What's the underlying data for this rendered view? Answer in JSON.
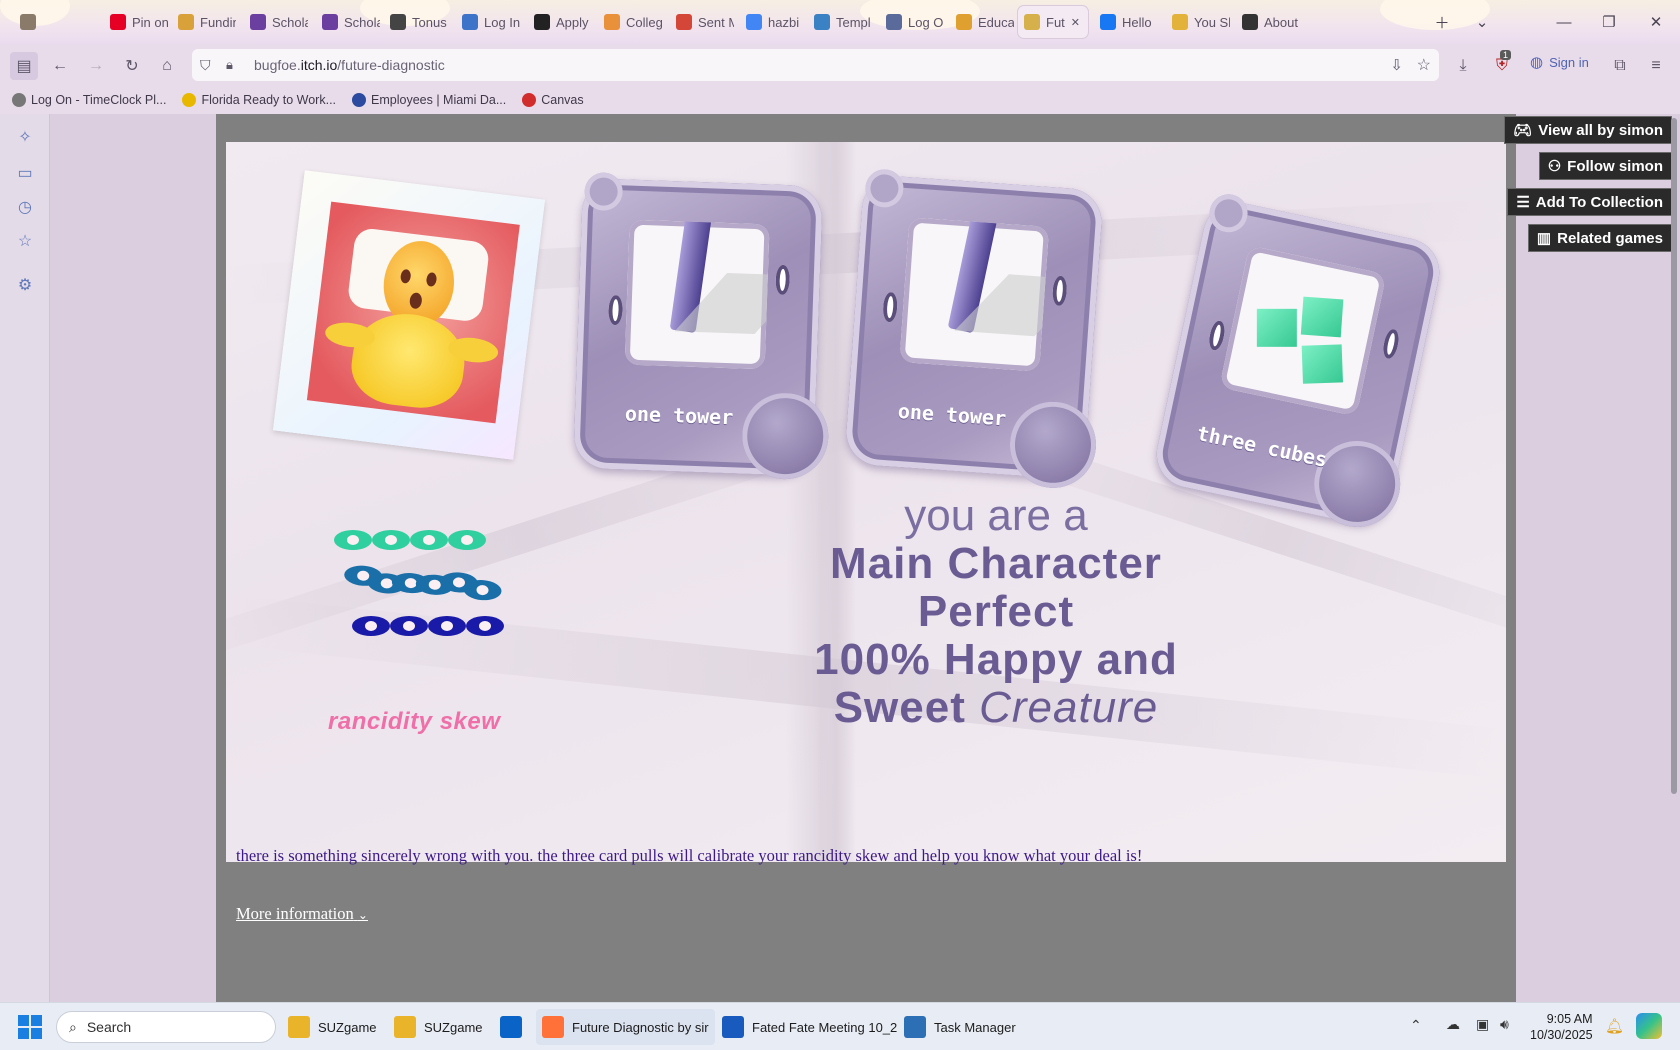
{
  "browser": {
    "tabs": [
      {
        "label": "",
        "fav": "#8a7a6a"
      },
      {
        "label": "Pin on",
        "fav": "#e60023"
      },
      {
        "label": "Funding y",
        "fav": "#d9a13a"
      },
      {
        "label": "Schola",
        "fav": "#6b3fa0"
      },
      {
        "label": "Schola",
        "fav": "#6b3fa0"
      },
      {
        "label": "Tonus",
        "fav": "#444444"
      },
      {
        "label": "Log In",
        "fav": "#3d73c8"
      },
      {
        "label": "Apply",
        "fav": "#222222"
      },
      {
        "label": "Colleg",
        "fav": "#e8913a"
      },
      {
        "label": "Sent M",
        "fav": "#d44638"
      },
      {
        "label": "hazbi",
        "fav": "#4285f4"
      },
      {
        "label": "Templ",
        "fav": "#3b82c4"
      },
      {
        "label": "Log O",
        "fav": "#5a6a9a"
      },
      {
        "label": "Educa",
        "fav": "#e0a030"
      },
      {
        "label": "Fut",
        "fav": "#d6b04a"
      },
      {
        "label": "Hello",
        "fav": "#1877f2"
      },
      {
        "label": "You Sh",
        "fav": "#e2b23a"
      },
      {
        "label": "About",
        "fav": "#333333"
      }
    ],
    "url_host": "bugfoe.",
    "url_domain": "itch.io",
    "url_path": "/future-diagnostic",
    "sign_in": "Sign in",
    "notify_count": "1"
  },
  "bookmarks": [
    {
      "label": "Log On - TimeClock Pl...",
      "color": "#777777"
    },
    {
      "label": "Florida Ready to Work...",
      "color": "#e8b800"
    },
    {
      "label": "Employees | Miami Da...",
      "color": "#2b4aa0"
    },
    {
      "label": "Canvas",
      "color": "#d22d2d"
    }
  ],
  "game": {
    "cards": [
      {
        "label": "one tower"
      },
      {
        "label": "one tower"
      },
      {
        "label": "three cubes"
      }
    ],
    "result_line1": "you are a",
    "result_line2": "Main Character",
    "result_line3": "Perfect",
    "result_line4": "100% Happy and",
    "result_line5a": "Sweet ",
    "result_line5b": "Creature",
    "rancidity": "rancidity skew"
  },
  "description": "there is something sincerely wrong with you. the three card pulls will calibrate your rancidity skew and help you know what your deal is!",
  "more_info": "More information",
  "game_actions": {
    "view_all": "View all by simon",
    "follow": "Follow simon",
    "add_collection": "Add To Collection",
    "related": "Related games"
  },
  "taskbar": {
    "search": "Search",
    "items": [
      {
        "label": "SUZgame",
        "color": "#e9b32a"
      },
      {
        "label": "SUZgame",
        "color": "#e9b32a"
      },
      {
        "label": "",
        "color": "#0a64c8"
      },
      {
        "label": "Future Diagnostic by sir",
        "color": "#ff7139"
      },
      {
        "label": "Fated Fate Meeting 10_2",
        "color": "#185abd"
      },
      {
        "label": "Task Manager",
        "color": "#2d6fb5"
      }
    ],
    "time": "9:05 AM",
    "date": "10/30/2025"
  }
}
